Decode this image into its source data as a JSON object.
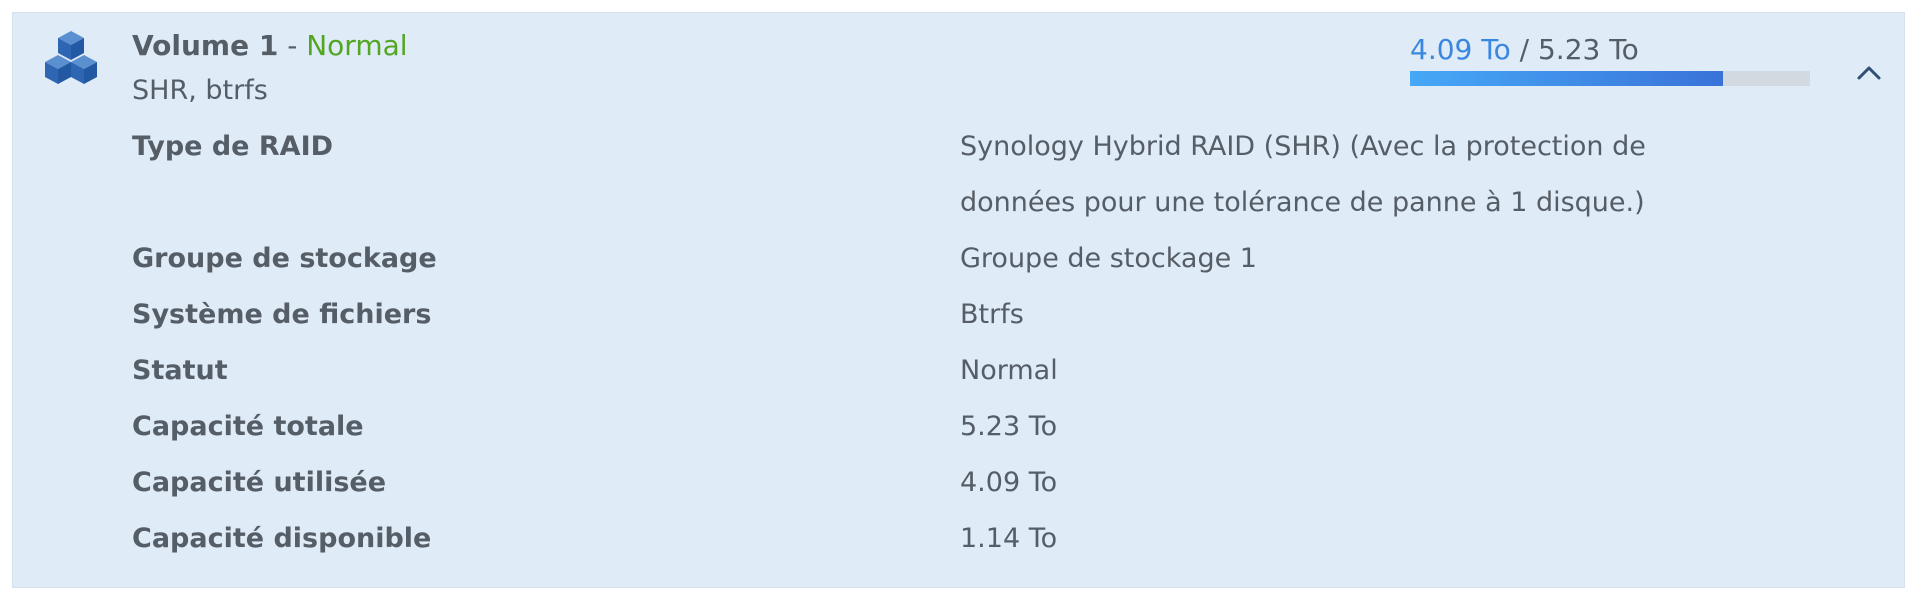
{
  "volume": {
    "name": "Volume 1",
    "separator": "-",
    "status": "Normal",
    "subtitle": "SHR, btrfs",
    "icon": "cubes-icon",
    "usage": {
      "used": "4.09 To",
      "separator": "/",
      "total": "5.23 To",
      "fraction_used": 0.782
    },
    "collapse_icon": "chevron-up-icon"
  },
  "details": [
    {
      "label": "Type de RAID",
      "value": "Synology Hybrid RAID (SHR) (Avec la protection de données pour une tolérance de panne à 1 disque.)"
    },
    {
      "label": "Groupe de stockage",
      "value": "Groupe de stockage 1"
    },
    {
      "label": "Système de fichiers",
      "value": "Btrfs"
    },
    {
      "label": "Statut",
      "value": "Normal"
    },
    {
      "label": "Capacité totale",
      "value": "5.23 To"
    },
    {
      "label": "Capacité utilisée",
      "value": "4.09 To"
    },
    {
      "label": "Capacité disponible",
      "value": "1.14 To"
    }
  ],
  "colors": {
    "panel_background": "#e0ebf8",
    "text": "#555d66",
    "status_ok": "#52a624",
    "used_accent": "#3a87e0",
    "bar_track": "#d3d9e0",
    "icon_blue": "#3167b1"
  }
}
